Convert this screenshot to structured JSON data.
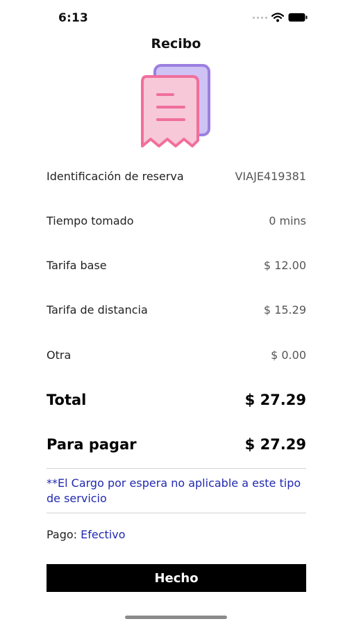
{
  "status_bar": {
    "time": "6:13"
  },
  "header": {
    "title": "Recibo"
  },
  "receipt": {
    "rows": [
      {
        "label": "Identificación de reserva",
        "value": "VIAJE419381"
      },
      {
        "label": "Tiempo tomado",
        "value": "0 mins"
      },
      {
        "label": "Tarifa base",
        "value": "$ 12.00"
      },
      {
        "label": "Tarifa de distancia",
        "value": "$ 15.29"
      },
      {
        "label": "Otra",
        "value": "$ 0.00"
      }
    ],
    "total": {
      "label": "Total",
      "value": "$ 27.29"
    },
    "to_pay": {
      "label": "Para pagar",
      "value": "$ 27.29"
    }
  },
  "note": "**El Cargo por espera no aplicable a este tipo de servicio",
  "payment": {
    "label": "Pago:",
    "method": "Efectivo"
  },
  "actions": {
    "done_label": "Hecho"
  },
  "icons": {
    "receipt": "receipt-icon",
    "wifi": "wifi-icon",
    "battery": "battery-icon",
    "signal": "cellular-signal-icon"
  },
  "colors": {
    "link_blue": "#2129b0",
    "receipt_pink": "#f06f9c",
    "receipt_purple": "#9b7fe0",
    "button_bg": "#000000"
  }
}
